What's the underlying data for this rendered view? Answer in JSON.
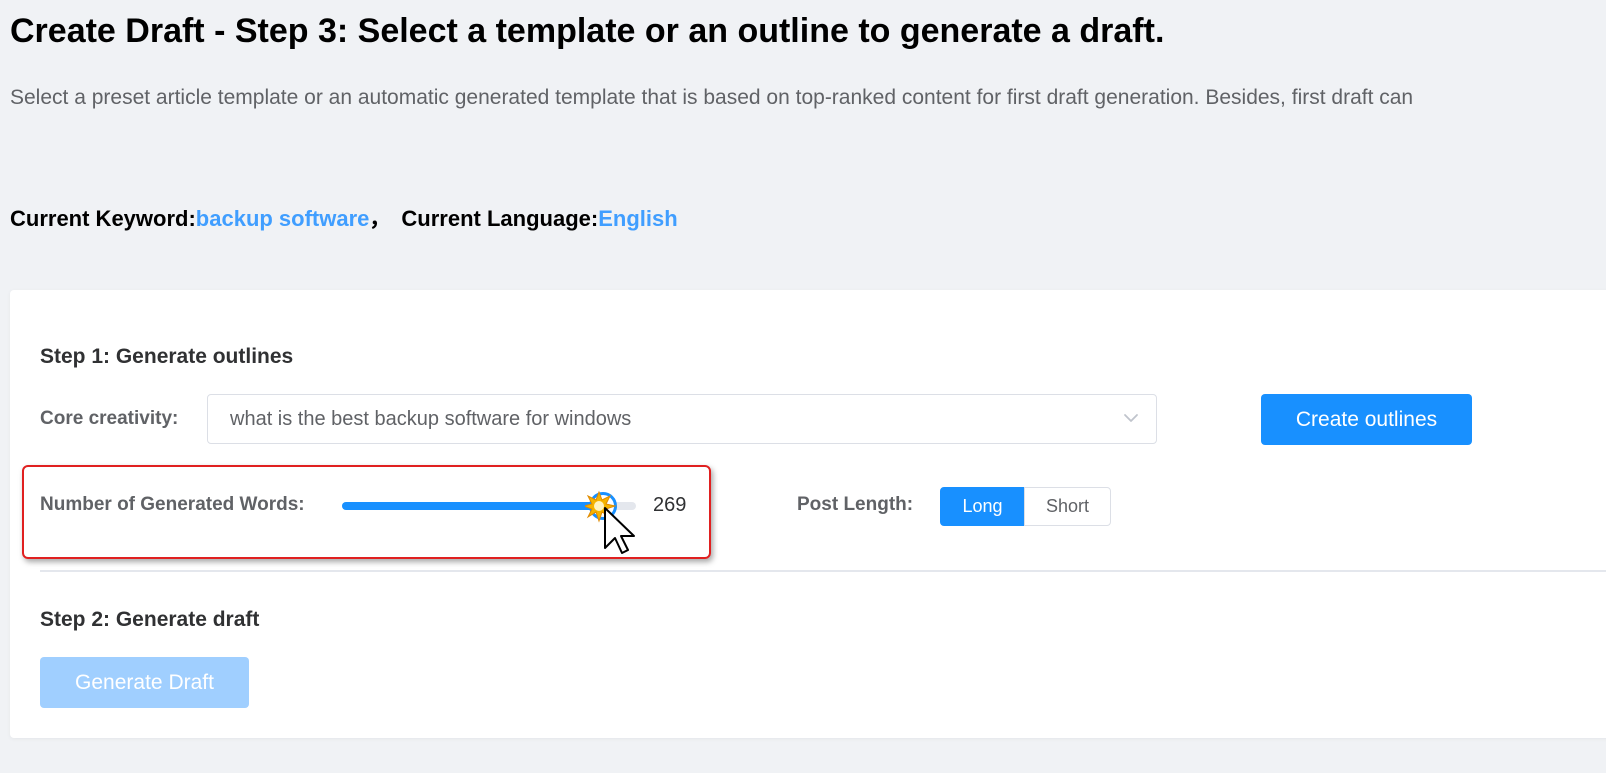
{
  "header": {
    "title": "Create Draft - Step 3: Select a template or an outline to generate a draft.",
    "description": "Select a preset article template or an automatic generated template that is based on top-ranked content for first draft generation. Besides, first draft can"
  },
  "keyword_line": {
    "keyword_label": "Current Keyword:",
    "keyword_value": "backup software",
    "separator": "，",
    "language_label": "Current Language:",
    "language_value": "English"
  },
  "step1": {
    "title": "Step 1: Generate outlines",
    "core_label": "Core creativity:",
    "core_value": "what is the best backup software for windows",
    "create_button": "Create outlines",
    "words_label": "Number of Generated Words:",
    "words_value": "269",
    "words_fill_fraction": 0.9,
    "post_length_label": "Post Length:",
    "post_length_options": [
      "Long",
      "Short"
    ],
    "post_length_selected": "Long"
  },
  "step2": {
    "title": "Step 2: Generate draft",
    "generate_button": "Generate Draft"
  },
  "colors": {
    "accent": "#1890ff",
    "link": "#409eff",
    "highlight_border": "#e02020",
    "disabled_button": "#a0cfff"
  },
  "icons": {
    "select_arrow": "chevron-down-icon",
    "pointer": "mouse-cursor-icon"
  }
}
